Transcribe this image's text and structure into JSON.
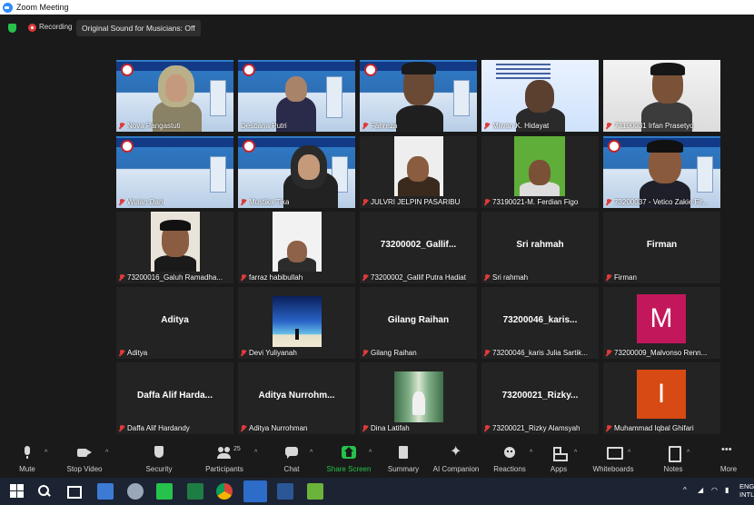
{
  "window": {
    "title": "Zoom Meeting"
  },
  "topbar": {
    "recording_label": "Recording",
    "sound_label": "Original Sound for Musicians: Off"
  },
  "tiles": [
    {
      "name": "Nova Pangastuti",
      "kind": "video",
      "muted": true
    },
    {
      "name": "Desbana Putri",
      "kind": "video",
      "muted": false,
      "active_speaker": true
    },
    {
      "name": "Fahreza",
      "kind": "video",
      "muted": true
    },
    {
      "name": "Miwan K. Hidayat",
      "kind": "video",
      "muted": true
    },
    {
      "name": "73190031 Irfan Prasetyo",
      "kind": "video",
      "muted": true
    },
    {
      "name": "Wulan Dani",
      "kind": "video",
      "muted": true
    },
    {
      "name": "Mustika Tika",
      "kind": "video",
      "muted": true
    },
    {
      "name": "JULVRI JELPIN PASARIBU",
      "kind": "video",
      "muted": true
    },
    {
      "name": "73190021-M. Ferdian Figo",
      "kind": "video",
      "muted": true
    },
    {
      "name": "73200037 - Vetico Zakie Fir...",
      "kind": "video",
      "muted": true
    },
    {
      "name": "73200016_Galuh Ramadha...",
      "kind": "video",
      "muted": true
    },
    {
      "name": "farraz habibullah",
      "kind": "video",
      "muted": true
    },
    {
      "name": "73200002_Gallif Putra Hadiat",
      "display": "73200002_Gallif...",
      "kind": "name",
      "muted": true
    },
    {
      "name": "Sri rahmah",
      "display": "Sri rahmah",
      "kind": "name",
      "muted": true
    },
    {
      "name": "Firman",
      "display": "Firman",
      "kind": "name",
      "muted": true
    },
    {
      "name": "Aditya",
      "display": "Aditya",
      "kind": "name",
      "muted": true
    },
    {
      "name": "Devi Yuliyanah",
      "kind": "video",
      "muted": true
    },
    {
      "name": "Gilang Raihan",
      "display": "Gilang Raihan",
      "kind": "name",
      "muted": true
    },
    {
      "name": "73200046_karis Julia Sartik...",
      "display": "73200046_karis...",
      "kind": "name",
      "muted": true
    },
    {
      "name": "73200009_Malvonso Renn...",
      "kind": "avatar",
      "letter": "M",
      "color": "#c2185b",
      "muted": true
    },
    {
      "name": "Daffa Alif Hardandy",
      "display": "Daffa Alif Harda...",
      "kind": "name",
      "muted": true
    },
    {
      "name": "Aditya Nurrohman",
      "display": "Aditya Nurrohm...",
      "kind": "name",
      "muted": true
    },
    {
      "name": "Dina Latifah",
      "kind": "video",
      "muted": true
    },
    {
      "name": "73200021_Rizky Alamsyah",
      "display": "73200021_Rizky...",
      "kind": "name",
      "muted": true
    },
    {
      "name": "Muhammad Iqbal Ghifari",
      "kind": "avatar",
      "letter": "I",
      "color": "#d84a13",
      "muted": true
    }
  ],
  "toolbar": {
    "mute": "Mute",
    "stop_video": "Stop Video",
    "security": "Security",
    "participants": "Participants",
    "participants_count": "25",
    "chat": "Chat",
    "share_screen": "Share Screen",
    "summary": "Summary",
    "ai_companion": "AI Companion",
    "reactions": "Reactions",
    "apps": "Apps",
    "whiteboards": "Whiteboards",
    "notes": "Notes",
    "more": "More"
  },
  "taskbar": {
    "lang_line1": "ENG",
    "lang_line2": "INTL"
  },
  "colors": {
    "accent_green": "#27c24c",
    "recording_red": "#e03a3a",
    "zoom_blue": "#2D8CFF",
    "active_speaker": "#c9e25a"
  }
}
